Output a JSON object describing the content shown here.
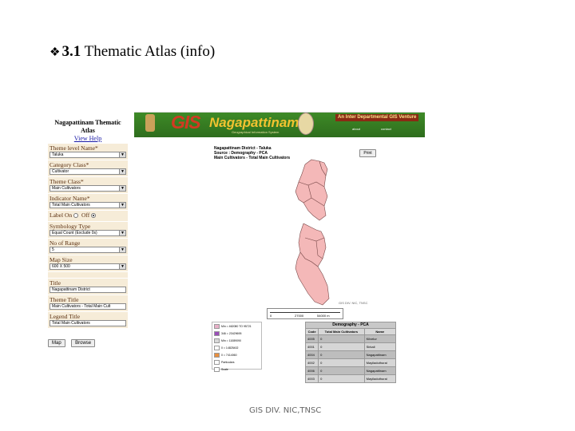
{
  "slide": {
    "title_number": "3.1",
    "title_rest": " Thematic Atlas (info)",
    "footer": "GIS DIV. NIC,TNSC"
  },
  "panel": {
    "title": "Nagapattinam Thematic Atlas",
    "help_link": "View Help",
    "theme_level": {
      "label": "Theme level Name*",
      "value": "Taluka"
    },
    "category_class": {
      "label": "Category Class*",
      "value": "Cultivator"
    },
    "theme_class": {
      "label": "Theme Class*",
      "value": "Main Cultivators"
    },
    "indicator": {
      "label": "Indicator Name*",
      "value": "Total Main Cultivators"
    },
    "label_toggle": {
      "label": "Label",
      "on": "On",
      "off": "Off"
    },
    "symbology": {
      "label": "Symbology Type",
      "value": "Equal Count (Exclude 0s)"
    },
    "no_of_range": {
      "label": "No of Range",
      "value": "5"
    },
    "map_size": {
      "label": "Map Size",
      "value": "600 X 500"
    },
    "title_field": {
      "label": "Title",
      "value": "Nagapattinam District"
    },
    "theme_title": {
      "label": "Theme Title",
      "value": "Main Cultivators - Total Main Cult"
    },
    "legend_title": {
      "label": "Legend Title",
      "value": "Total Main Cultivators"
    },
    "map_button": "Map",
    "browse_button": "Browse"
  },
  "banner": {
    "logo_gis": "GIS",
    "logo_name": "Nagapattinam",
    "subtitle": "Geographical Information System",
    "venture": "An Inter Departmental GIS Venture",
    "link1": "about",
    "link2": "contact"
  },
  "map": {
    "head_line1": "Nagapattinam District - Taluka",
    "head_line2": "Source : Demography - PCA",
    "head_line3": "Main Cultivators - Total Main Cultivators",
    "print_button": "Print",
    "copyright": "GIS DIV. NIC, TNSC",
    "scale_start": "0",
    "scale_mid": "27000",
    "scale_end": "54000 m",
    "fill_color": "#f4b8b8"
  },
  "legend": {
    "items": [
      {
        "label": "Min = 462080 TO 95721",
        "color": "#e8b0c8"
      },
      {
        "label": "346 = 23429695",
        "color": "#9a4fb8"
      },
      {
        "label": "Min = 11089090",
        "color": "#d8d8d8"
      },
      {
        "label": "0 = 14825402",
        "color": "#ffffff"
      },
      {
        "label": "0 = 7414060",
        "color": "#e89040"
      },
      {
        "label": "Particulars",
        "color": "#ffffff"
      },
      {
        "label": "Scale",
        "color": "#ffffff"
      }
    ]
  },
  "table": {
    "caption": "Demography - PCA",
    "headers": [
      "Code",
      "Total Main Cultivators",
      "Name"
    ],
    "rows": [
      [
        "4005",
        "0",
        "Kilvelur"
      ],
      [
        "4001",
        "0",
        "Sirkali"
      ],
      [
        "4004",
        "0",
        "Nagapattinam"
      ],
      [
        "4002",
        "0",
        "Mayiladuthurai"
      ],
      [
        "4006",
        "0",
        "Nagapattinam"
      ],
      [
        "4003",
        "0",
        "Mayiladuthurai"
      ]
    ]
  }
}
